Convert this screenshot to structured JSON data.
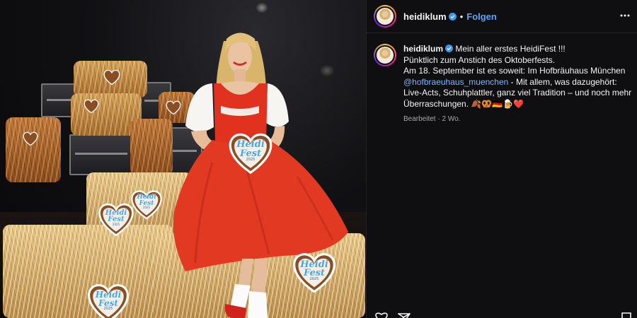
{
  "post": {
    "username": "heidiklum",
    "follow_label": "Folgen",
    "separator": "•",
    "caption_lines": [
      "Mein aller erstes HeidiFest !!!",
      "Pünktlich zum Anstich des Oktoberfests.",
      "Am 18. September ist es soweit: Im Hofbräuhaus München",
      "@hofbraeuhaus_muenchen",
      " - Mit allem, was dazugehört:",
      "Live-Acts, Schuhplattler, ganz viel Tradition – und noch mehr",
      "Überraschungen. 🍂🥨🇩🇪🍺❤️"
    ],
    "edited_label": "Bearbeitet",
    "meta_separator": "·",
    "time_ago": "2 Wo."
  },
  "photo": {
    "heart_title_line1": "Heidi",
    "heart_title_line2": "Fest",
    "heart_year": "2025"
  },
  "colors": {
    "accent_link": "#5aa4ff",
    "panel_bg": "#0f0f11",
    "dirndl_red": "#e23a22"
  },
  "icons": [
    "verified-badge-icon",
    "more-options-icon",
    "heart-icon",
    "share-icon",
    "bookmark-icon"
  ]
}
